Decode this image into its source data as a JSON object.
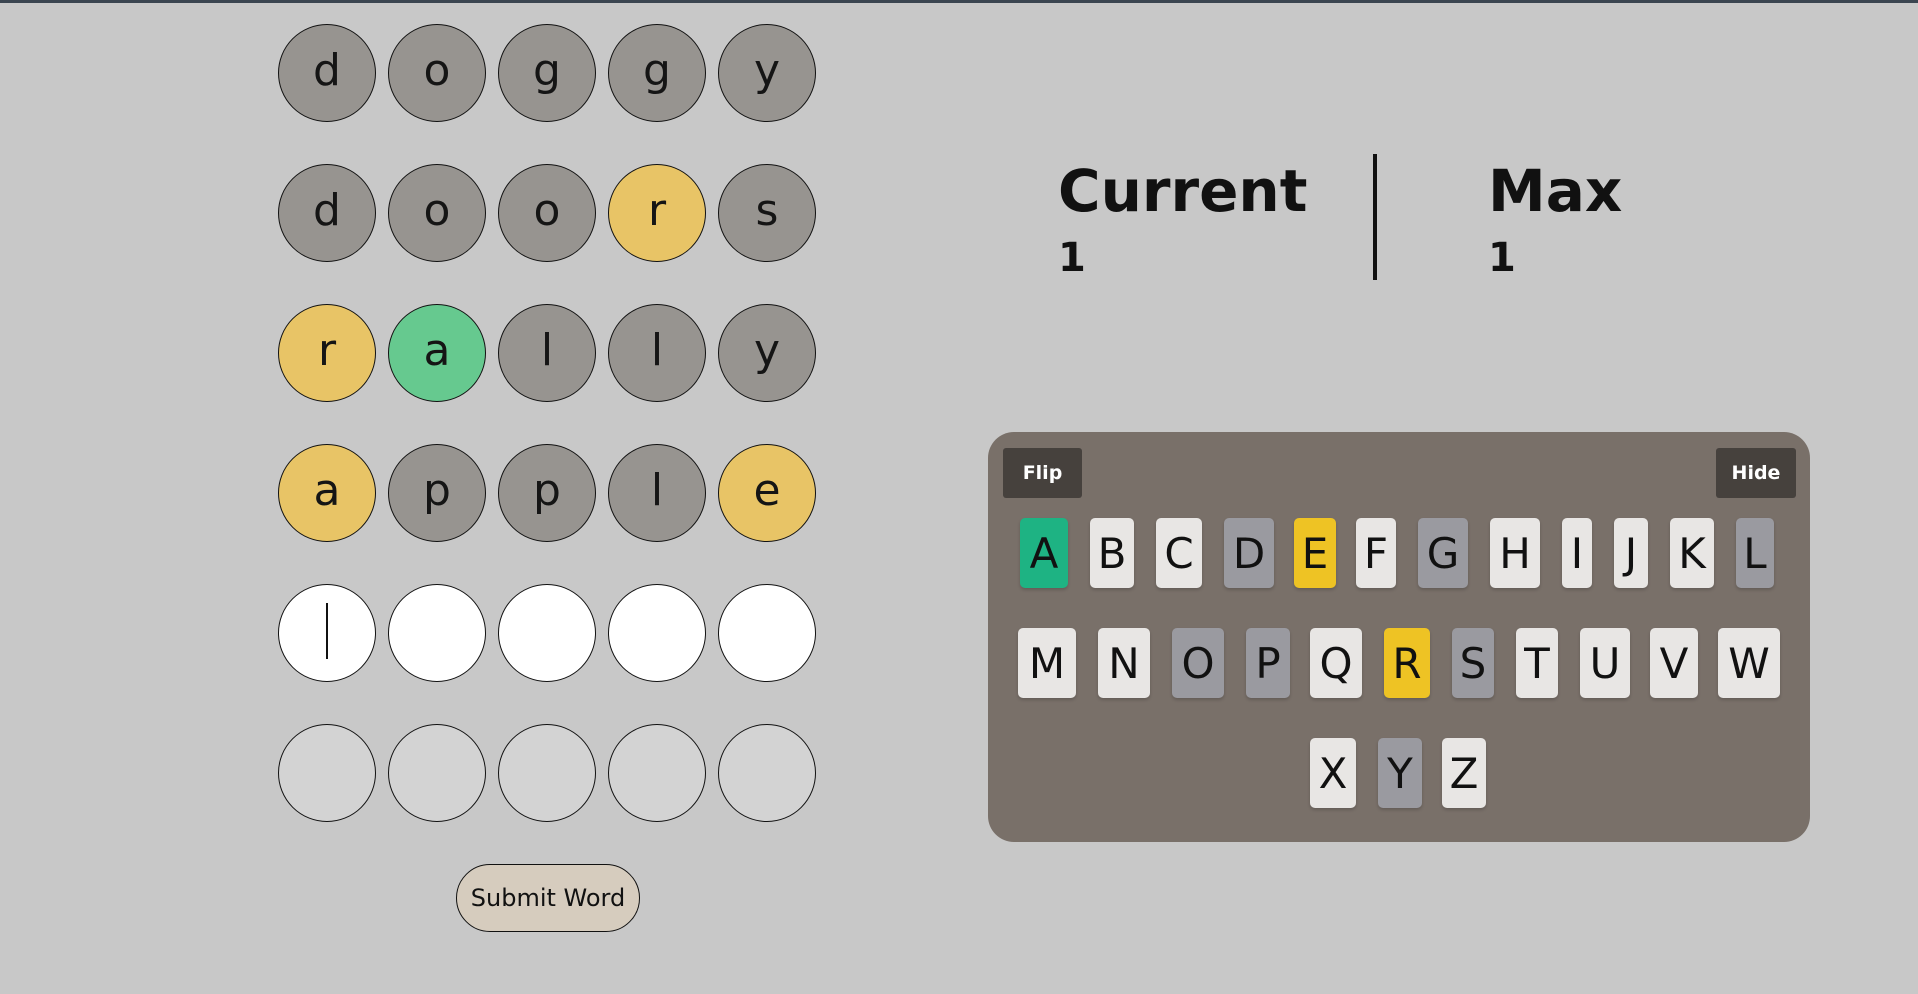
{
  "board": {
    "rows": [
      {
        "tiles": [
          {
            "letter": "d",
            "state": "absent"
          },
          {
            "letter": "o",
            "state": "absent"
          },
          {
            "letter": "g",
            "state": "absent"
          },
          {
            "letter": "g",
            "state": "absent"
          },
          {
            "letter": "y",
            "state": "absent"
          }
        ]
      },
      {
        "tiles": [
          {
            "letter": "d",
            "state": "absent"
          },
          {
            "letter": "o",
            "state": "absent"
          },
          {
            "letter": "o",
            "state": "absent"
          },
          {
            "letter": "r",
            "state": "present"
          },
          {
            "letter": "s",
            "state": "absent"
          }
        ]
      },
      {
        "tiles": [
          {
            "letter": "r",
            "state": "present"
          },
          {
            "letter": "a",
            "state": "correct"
          },
          {
            "letter": "l",
            "state": "absent"
          },
          {
            "letter": "l",
            "state": "absent"
          },
          {
            "letter": "y",
            "state": "absent"
          }
        ]
      },
      {
        "tiles": [
          {
            "letter": "a",
            "state": "present"
          },
          {
            "letter": "p",
            "state": "absent"
          },
          {
            "letter": "p",
            "state": "absent"
          },
          {
            "letter": "l",
            "state": "absent"
          },
          {
            "letter": "e",
            "state": "present"
          }
        ]
      },
      {
        "tiles": [
          {
            "letter": "",
            "state": "current"
          },
          {
            "letter": "",
            "state": "current"
          },
          {
            "letter": "",
            "state": "current"
          },
          {
            "letter": "",
            "state": "current"
          },
          {
            "letter": "",
            "state": "current"
          }
        ]
      },
      {
        "tiles": [
          {
            "letter": "",
            "state": "empty"
          },
          {
            "letter": "",
            "state": "empty"
          },
          {
            "letter": "",
            "state": "empty"
          },
          {
            "letter": "",
            "state": "empty"
          },
          {
            "letter": "",
            "state": "empty"
          }
        ]
      }
    ],
    "submit_label": "Submit Word"
  },
  "scores": {
    "current_label": "Current",
    "current_value": "1",
    "max_label": "Max",
    "max_value": "1"
  },
  "keyboard": {
    "flip_label": "Flip",
    "hide_label": "Hide",
    "rows": [
      [
        {
          "letter": "A",
          "state": "correct"
        },
        {
          "letter": "B",
          "state": "unused"
        },
        {
          "letter": "C",
          "state": "unused"
        },
        {
          "letter": "D",
          "state": "absent"
        },
        {
          "letter": "E",
          "state": "present"
        },
        {
          "letter": "F",
          "state": "unused"
        },
        {
          "letter": "G",
          "state": "absent"
        },
        {
          "letter": "H",
          "state": "unused"
        },
        {
          "letter": "I",
          "state": "unused"
        },
        {
          "letter": "J",
          "state": "unused"
        },
        {
          "letter": "K",
          "state": "unused"
        },
        {
          "letter": "L",
          "state": "absent"
        }
      ],
      [
        {
          "letter": "M",
          "state": "unused"
        },
        {
          "letter": "N",
          "state": "unused"
        },
        {
          "letter": "O",
          "state": "absent"
        },
        {
          "letter": "P",
          "state": "absent"
        },
        {
          "letter": "Q",
          "state": "unused"
        },
        {
          "letter": "R",
          "state": "present"
        },
        {
          "letter": "S",
          "state": "absent"
        },
        {
          "letter": "T",
          "state": "unused"
        },
        {
          "letter": "U",
          "state": "unused"
        },
        {
          "letter": "V",
          "state": "unused"
        },
        {
          "letter": "W",
          "state": "unused"
        }
      ],
      [
        {
          "letter": "X",
          "state": "unused"
        },
        {
          "letter": "Y",
          "state": "absent"
        },
        {
          "letter": "Z",
          "state": "unused"
        }
      ]
    ]
  },
  "colors": {
    "background": "#c8c8c8",
    "tile_absent": "#979490",
    "tile_present": "#e8c466",
    "tile_correct": "#66c98f",
    "key_absent": "#9a9aa0",
    "key_present": "#eec324",
    "key_correct": "#1eb383",
    "keyboard_panel": "#797069",
    "submit_button": "#d6ccbe"
  }
}
